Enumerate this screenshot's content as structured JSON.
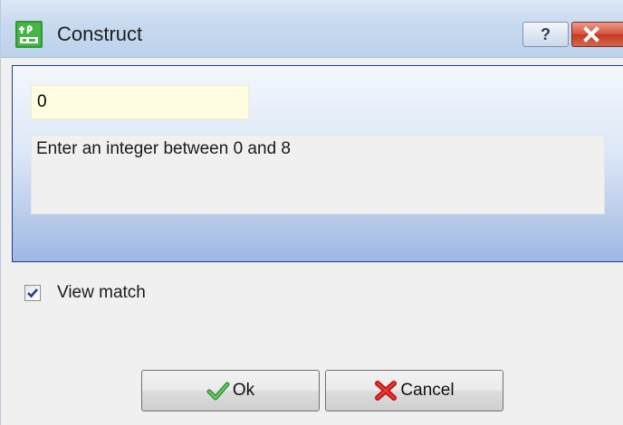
{
  "window": {
    "title": "Construct",
    "help_label": "?"
  },
  "panel": {
    "input_value": "0",
    "hint": "Enter an integer between 0 and 8"
  },
  "options": {
    "view_match_label": "View match",
    "view_match_checked": true
  },
  "buttons": {
    "ok_label": "Ok",
    "cancel_label": "Cancel"
  },
  "colors": {
    "panel_border": "#1e3f8a",
    "input_background": "#fffde1",
    "ok_icon": "#3aa33a",
    "cancel_icon": "#d42020"
  },
  "icons": {
    "app": "construct-app-icon",
    "help": "question-icon",
    "close": "close-icon",
    "ok": "checkmark-icon",
    "cancel": "cross-icon"
  }
}
